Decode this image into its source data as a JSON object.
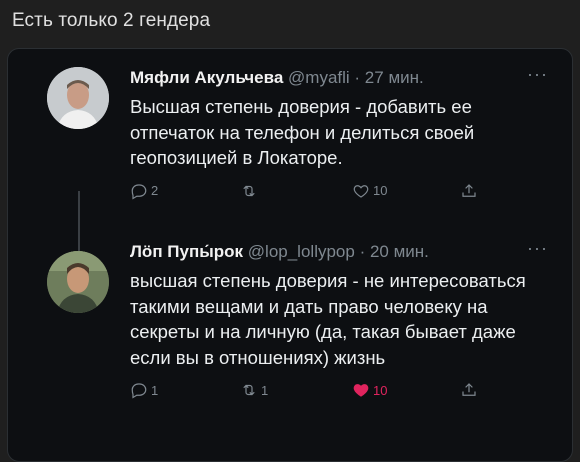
{
  "caption": "Есть только 2 гендера",
  "tweets": [
    {
      "name": "Мяфли Акульчева",
      "handle": "@myafli",
      "time": "· 27 мин.",
      "more": "···",
      "text": "Высшая степень доверия - добавить ее отпечаток на телефон и делиться своей геопозицией в Локаторе.",
      "replies": "2",
      "retweets": "",
      "likes": "10",
      "liked": false
    },
    {
      "name": "Лöп Пупы́рок",
      "handle": "@lop_lollypop",
      "time": "· 20 мин.",
      "more": "···",
      "text": "высшая степень доверия - не интересоваться такими вещами и дать право человеку на секреты и на личную (да, такая бывает даже если вы в отношениях) жизнь",
      "replies": "1",
      "retweets": "1",
      "likes": "10",
      "liked": true
    }
  ],
  "colors": {
    "background": "#1f1f1f",
    "card": "#0d0f12",
    "meta": "#7f8890",
    "like": "#e0245e"
  },
  "icons": [
    "reply-icon",
    "retweet-icon",
    "like-icon",
    "share-icon",
    "more-icon"
  ]
}
